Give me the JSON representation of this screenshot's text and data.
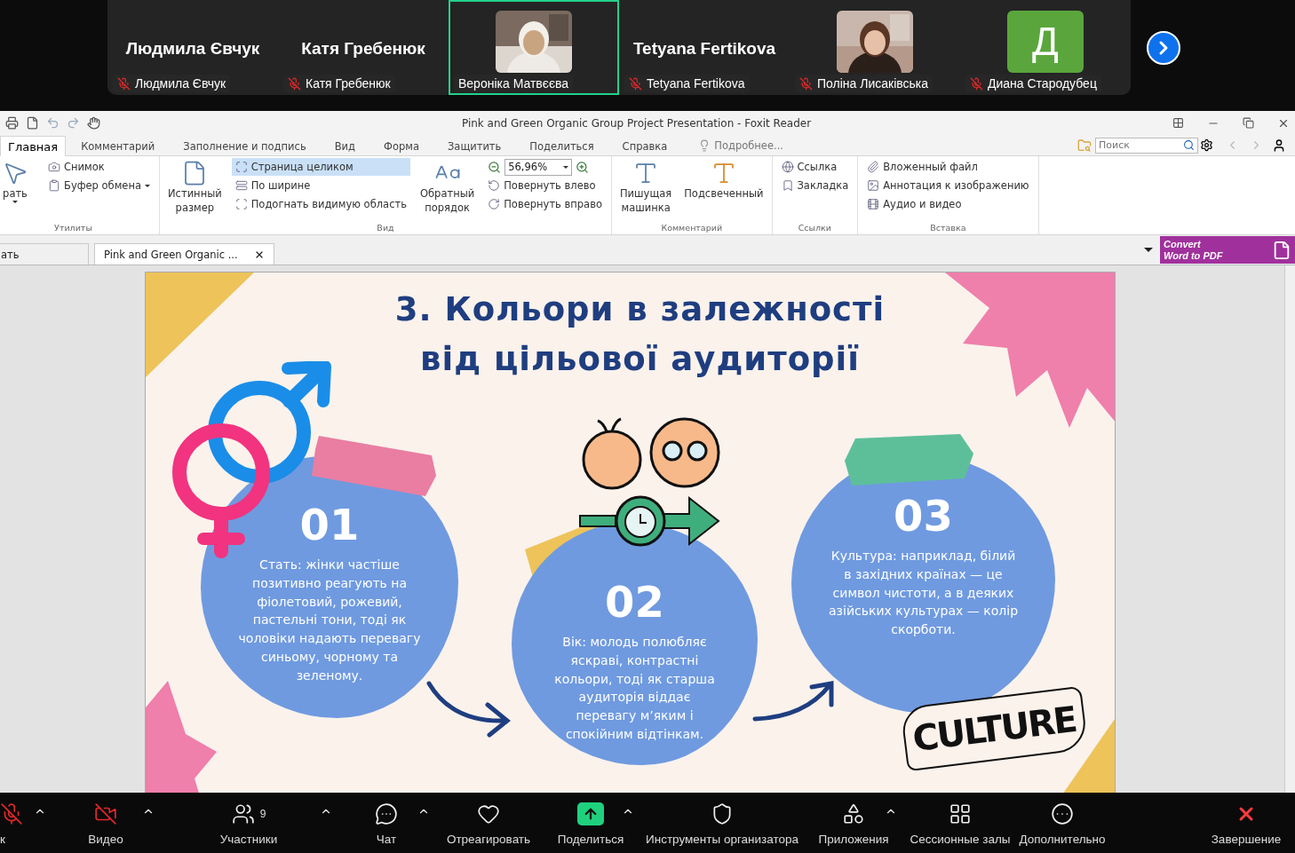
{
  "meeting": {
    "participants": [
      {
        "kind": "name",
        "title": "Людмила Євчук",
        "label": "Людмила Євчук",
        "muted": true,
        "selected": false
      },
      {
        "kind": "name",
        "title": "Катя Гребенюк",
        "label": "Катя Гребенюк",
        "muted": true,
        "selected": false
      },
      {
        "kind": "video",
        "label": "Вероніка Матвєєва",
        "muted": false,
        "selected": true
      },
      {
        "kind": "name",
        "title": "Tetyana Fertikova",
        "label": "Tetyana Fertikova",
        "muted": true,
        "selected": false
      },
      {
        "kind": "video",
        "label": "Поліна Лисаківська",
        "muted": true,
        "selected": false
      },
      {
        "kind": "avatar",
        "avatar": "Д",
        "label": "Диана Стародубец",
        "muted": true,
        "selected": false
      }
    ]
  },
  "window": {
    "title": "Pink and Green Organic Group Project Presentation - Foxit Reader"
  },
  "menu": {
    "tabs": [
      {
        "label": "Главная",
        "selected": true
      },
      {
        "label": "Комментарий",
        "selected": false
      },
      {
        "label": "Заполнение и подпись",
        "selected": false
      },
      {
        "label": "Вид",
        "selected": false
      },
      {
        "label": "Форма",
        "selected": false
      },
      {
        "label": "Защитить",
        "selected": false
      },
      {
        "label": "Поделиться",
        "selected": false
      },
      {
        "label": "Справка",
        "selected": false
      }
    ],
    "tell_me": "Подробнее...",
    "search": {
      "placeholder": "Поиск"
    }
  },
  "ribbon": {
    "groups": [
      {
        "label": "Утилиты",
        "columns": [
          {
            "kind": "large",
            "label": "рать",
            "dropdown": true
          },
          {
            "kind": "stack",
            "items": [
              {
                "label": "Снимок",
                "selected": false
              },
              {
                "label": "Буфер обмена",
                "selected": false,
                "dropdown": true
              }
            ]
          }
        ]
      },
      {
        "label": "Вид",
        "columns": [
          {
            "kind": "large",
            "label": "Истинный размер"
          },
          {
            "kind": "stack",
            "items": [
              {
                "label": "Страница целиком",
                "selected": true
              },
              {
                "label": "По ширине",
                "selected": false
              },
              {
                "label": "Подогнать видимую область",
                "selected": false
              }
            ]
          },
          {
            "kind": "large",
            "label": "Обратный порядок"
          },
          {
            "kind": "zoom",
            "value": "56,96%",
            "items": [
              {
                "label": "Повернуть влево",
                "selected": false
              },
              {
                "label": "Повернуть вправо",
                "selected": false
              }
            ]
          }
        ]
      },
      {
        "label": "Комментарий",
        "columns": [
          {
            "kind": "large",
            "label": "Пишущая машинка"
          },
          {
            "kind": "large",
            "label": "Подсвеченный"
          }
        ]
      },
      {
        "label": "Ссылки",
        "columns": [
          {
            "kind": "stack",
            "items": [
              {
                "label": "Ссылка",
                "selected": false
              },
              {
                "label": "Закладка",
                "selected": false
              }
            ]
          }
        ]
      },
      {
        "label": "Вставка",
        "columns": [
          {
            "kind": "stack",
            "items": [
              {
                "label": "Вложенный файл",
                "selected": false
              },
              {
                "label": "Аннотация к изображению",
                "selected": false
              },
              {
                "label": "Аудио и видео",
                "selected": false
              }
            ]
          }
        ]
      }
    ]
  },
  "doc_tabs": [
    {
      "label": "ать",
      "selected": false
    },
    {
      "label": "Pink and Green Organic ...",
      "selected": true,
      "closable": true
    }
  ],
  "convert_banner": {
    "line_1": "Convert",
    "line_2": "Word to PDF"
  },
  "slide": {
    "title_lines": [
      "3. Кольори в залежності",
      "від цільової аудиторії"
    ],
    "cards": [
      {
        "number": "01",
        "text": "Стать: жінки частіше позитивно реагують на фіолетовий, рожевий, пастельні тони, тоді як чоловіки надають перевагу синьому, чорному та зеленому."
      },
      {
        "number": "02",
        "text": "Вік: молодь полюбляє яскраві, контрастні кольори, тоді як старша аудиторія віддає перевагу м’яким і спокійним відтінкам."
      },
      {
        "number": "03",
        "text": "Культура: наприклад, білий в західних країнах — це символ чистоти, а в деяких азійських культурах — колір скорботи."
      }
    ],
    "lettering": "CULTURE"
  },
  "toolbar": {
    "items": [
      {
        "label": "к",
        "caret": true
      },
      {
        "label": "Видео",
        "caret": true
      },
      {
        "label": "Участники",
        "caret": true,
        "count": "9"
      },
      {
        "label": "Чат",
        "caret": true
      },
      {
        "label": "Отреагировать"
      },
      {
        "label": "Поделиться",
        "caret": true
      },
      {
        "label": "Инструменты организатора"
      },
      {
        "label": "Приложения",
        "caret": true
      },
      {
        "label": "Сессионные залы"
      },
      {
        "label": "Дополнительно"
      }
    ],
    "end": {
      "label": "Завершение"
    }
  }
}
